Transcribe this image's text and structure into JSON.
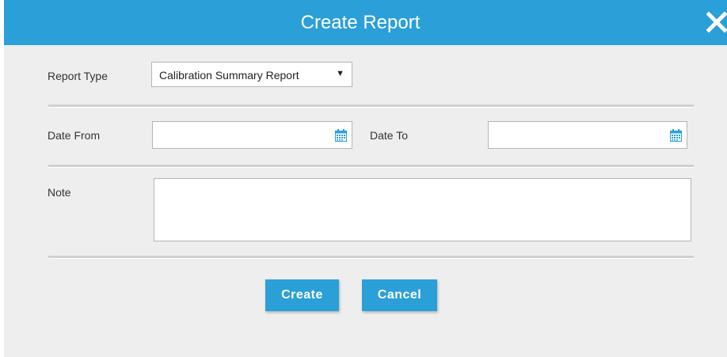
{
  "dialog": {
    "title": "Create Report",
    "close_icon": "close-icon"
  },
  "form": {
    "report_type_label": "Report Type",
    "report_type_value": "Calibration Summary Report",
    "date_from_label": "Date From",
    "date_from_value": "",
    "date_to_label": "Date To",
    "date_to_value": "",
    "note_label": "Note",
    "note_value": ""
  },
  "buttons": {
    "create_label": "Create",
    "cancel_label": "Cancel"
  },
  "colors": {
    "accent": "#2b9fd8",
    "background": "#eeeeee"
  }
}
